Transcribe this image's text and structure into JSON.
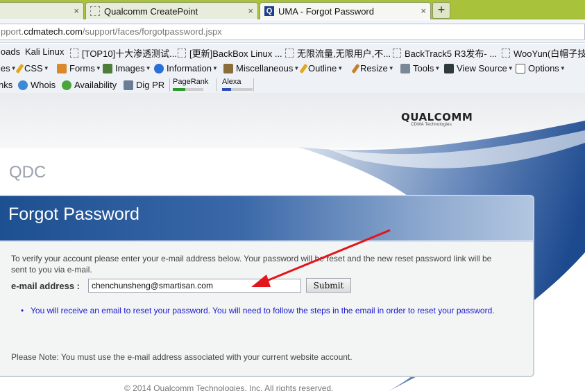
{
  "tabs": [
    {
      "label": "",
      "active": false
    },
    {
      "label": "Qualcomm CreatePoint",
      "active": false
    },
    {
      "label": "UMA - Forgot Password",
      "active": true
    }
  ],
  "new_tab_label": "+",
  "close_glyph": "×",
  "address": {
    "prefix": "pport.",
    "domain": "cdmatech.com",
    "path": "/support/faces/forgotpassword.jspx"
  },
  "bookmarks": [
    "loads",
    "Kali Linux",
    "[TOP10]十大渗透测试...",
    "[更新]BackBox Linux ...",
    "无限流量,无限用户,不...",
    "BackTrack5 R3发布- ...",
    "WooYun(白帽子技"
  ],
  "devtoolbar": [
    "ies",
    "CSS",
    "Forms",
    "Images",
    "Information",
    "Miscellaneous",
    "Outline",
    "Resize",
    "Tools",
    "View Source",
    "Options"
  ],
  "seotoolbar": {
    "items": [
      "nks",
      "Whois",
      "Availability",
      "Dig PR"
    ],
    "pagerank_label": "PageRank",
    "alexa_label": "Alexa",
    "pagerank_level": 0.4,
    "alexa_level": 0.3
  },
  "page": {
    "logo_text": "QUALCOMM",
    "logo_sub": "CDMA Technologies",
    "site_label": "QDC",
    "panel_title": "Forgot Password",
    "intro": "To verify your account please enter your e-mail address below. Your password will be reset and the new reset password link will be sent to you via e-mail.",
    "email_label": "e-mail address :",
    "email_value": "chenchunsheng@smartisan.com",
    "submit_label": "Submit",
    "notice": "You will receive an email to reset your password. You will need to follow the steps in the email in order to reset your password.",
    "note": "Please Note: You must use the e-mail address associated with your current website account.",
    "footer": "© 2014 Qualcomm Technologies, Inc. All rights reserved."
  },
  "colors": {
    "tabstrip": "#a9c23b",
    "panel_head": "#1d5091",
    "notice_text": "#1b1bcf",
    "arrow": "#e4141b"
  }
}
